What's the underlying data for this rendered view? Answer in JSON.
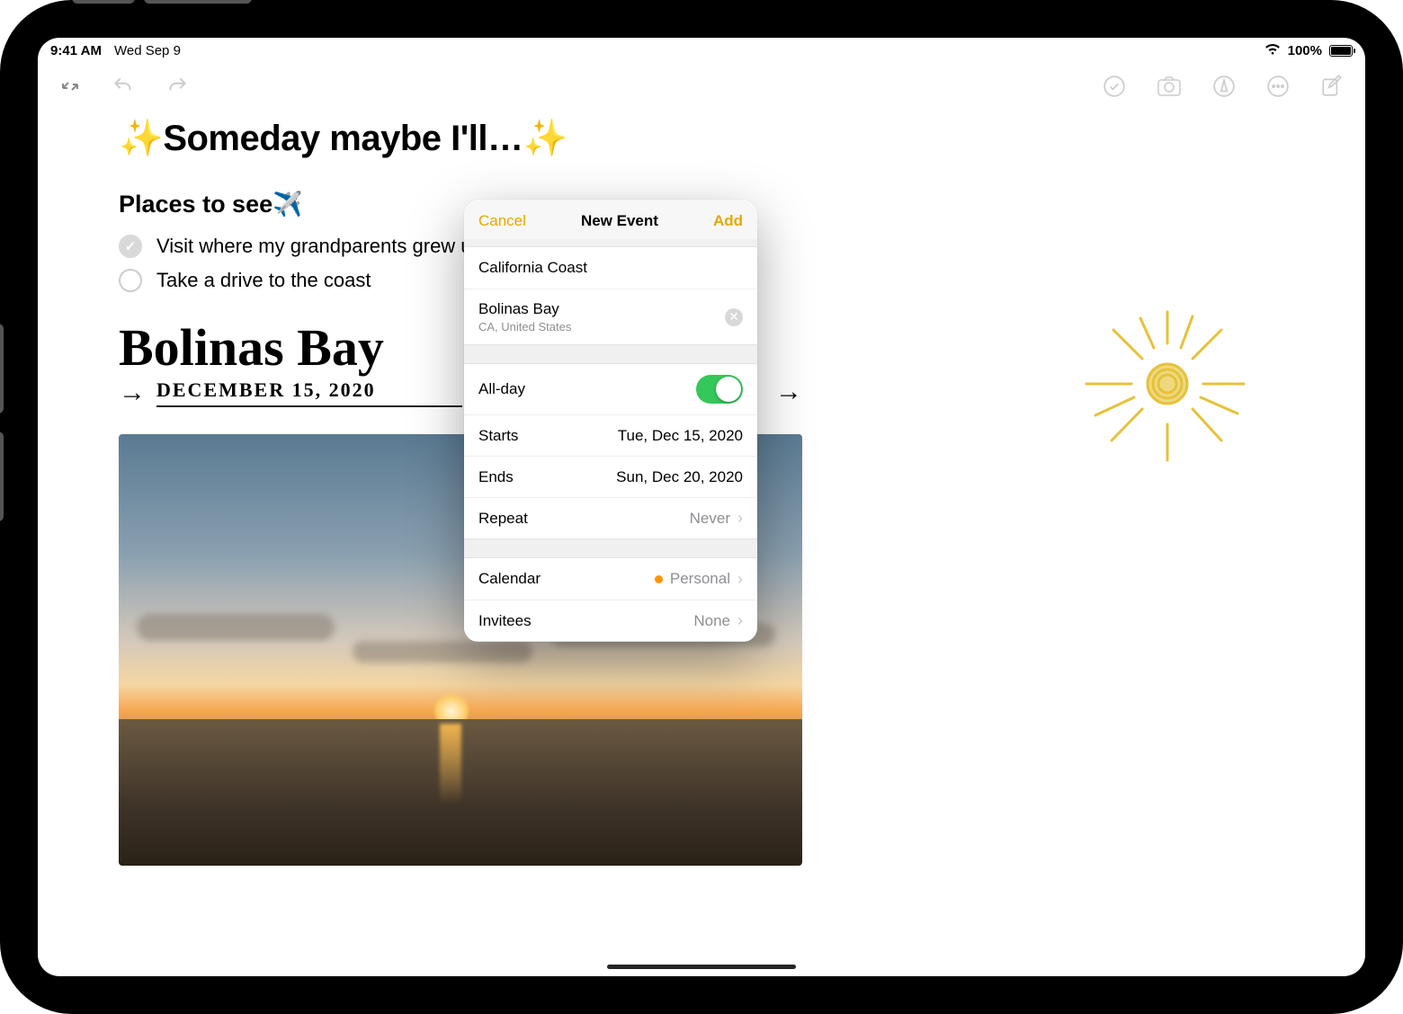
{
  "status": {
    "time": "9:41 AM",
    "date": "Wed Sep 9",
    "battery": "100%"
  },
  "toolbar": {
    "collapse": "collapse-icon",
    "undo": "undo-icon",
    "redo": "redo-icon",
    "checklist": "checklist-icon",
    "camera": "camera-icon",
    "markup": "markup-icon",
    "more": "more-icon",
    "compose": "compose-icon"
  },
  "note": {
    "title_prefix": "✨",
    "title": "Someday maybe I'll…",
    "title_suffix": "✨",
    "section": "Places to see",
    "section_emoji": "✈️",
    "items": [
      {
        "done": true,
        "text": "Visit where my grandparents grew up"
      },
      {
        "done": false,
        "text": "Take a drive to the coast"
      }
    ],
    "handwriting": {
      "place": "Bolinas Bay",
      "arrow": "→",
      "date": "DECEMBER 15, 2020"
    }
  },
  "popover": {
    "cancel": "Cancel",
    "title": "New Event",
    "add": "Add",
    "event_title": "California Coast",
    "location": {
      "name": "Bolinas Bay",
      "detail": "CA, United States"
    },
    "allday": {
      "label": "All-day",
      "on": true
    },
    "starts": {
      "label": "Starts",
      "value": "Tue, Dec 15, 2020"
    },
    "ends": {
      "label": "Ends",
      "value": "Sun, Dec 20, 2020"
    },
    "repeat": {
      "label": "Repeat",
      "value": "Never"
    },
    "calendar": {
      "label": "Calendar",
      "value": "Personal",
      "color": "#ff9500"
    },
    "invitees": {
      "label": "Invitees",
      "value": "None"
    }
  }
}
